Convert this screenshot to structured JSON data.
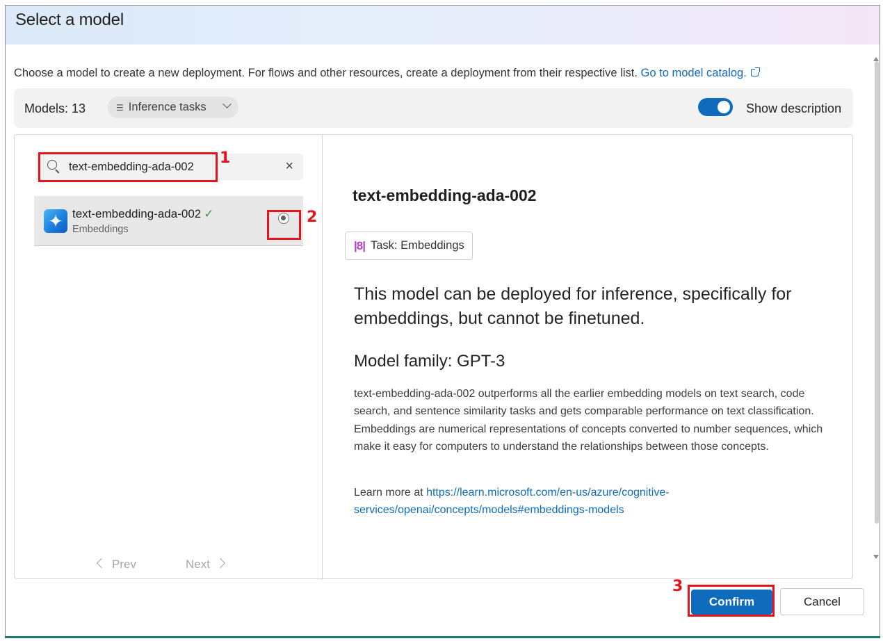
{
  "dialog": {
    "title": "Select a model",
    "intro_text": "Choose a model to create a new deployment. For flows and other resources, create a deployment from their respective list.",
    "catalog_link": "Go to model catalog."
  },
  "toolbar": {
    "models_count": "Models: 13",
    "filter_label": "Inference tasks",
    "show_description_label": "Show description",
    "show_description_on": true
  },
  "search": {
    "value": "text-embedding-ada-002",
    "clear_icon": "×"
  },
  "model_list": {
    "items": [
      {
        "name": "text-embedding-ada-002",
        "subtitle": "Embeddings",
        "selected": true
      }
    ],
    "prev_label": "Prev",
    "next_label": "Next"
  },
  "detail": {
    "title": "text-embedding-ada-002",
    "task_chip": "Task: Embeddings",
    "summary": "This model can be deployed for inference, specifically for embeddings, but cannot be finetuned.",
    "family": "Model family: GPT-3",
    "body": "text-embedding-ada-002 outperforms all the earlier embedding models on text search, code search, and sentence similarity tasks and gets comparable performance on text classification. Embeddings are numerical representations of concepts converted to number sequences, which make it easy for computers to understand the relationships between those concepts.",
    "learn_more_prefix": "Learn more at ",
    "learn_more_link": "https://learn.microsoft.com/en-us/azure/cognitive-services/openai/concepts/models#embeddings-models"
  },
  "footer": {
    "confirm_label": "Confirm",
    "cancel_label": "Cancel"
  },
  "annotations": {
    "step1": "1",
    "step2": "2",
    "step3": "3"
  },
  "colors": {
    "accent": "#0f6cbd",
    "highlight": "#e4141e",
    "verified": "#2e9e4a"
  }
}
